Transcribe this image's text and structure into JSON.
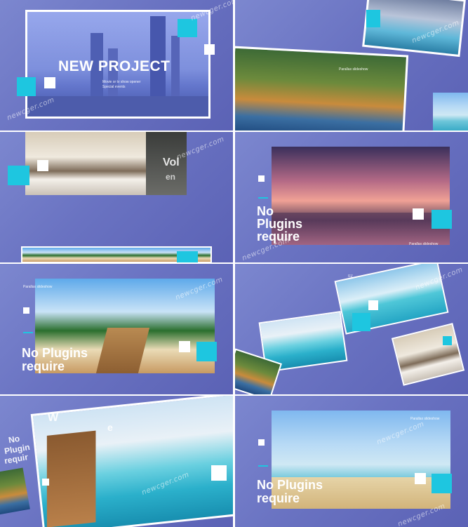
{
  "panels": {
    "p1": {
      "title": "NEW PROJECT",
      "subtitle_line1": "Movie or tv show opener",
      "subtitle_line2": "Special events"
    },
    "p2": {
      "caption": "Parallax slideshow"
    },
    "p3": {
      "fragment_a": "Vol",
      "fragment_b": "en"
    },
    "p4": {
      "title_line1": "No",
      "title_line2": "Plugins",
      "title_line3": "require",
      "caption": "Parallax slideshow"
    },
    "p5": {
      "caption": "Parallax slideshow",
      "title_line1": "No Plugins",
      "title_line2": "require"
    },
    "p6": {
      "number": "02"
    },
    "p7": {
      "fragment_a": "W",
      "fragment_b": "e",
      "fragment_c": "No",
      "fragment_d": "Plugin",
      "fragment_e": "requir"
    },
    "p8": {
      "caption": "Parallax slideshow",
      "title_line1": "No Plugins",
      "title_line2": "require"
    }
  },
  "watermark": "newcger.com",
  "colors": {
    "accent": "#1ec6e0",
    "panel_bg": "#6a73c2",
    "square": "#ffffff"
  }
}
